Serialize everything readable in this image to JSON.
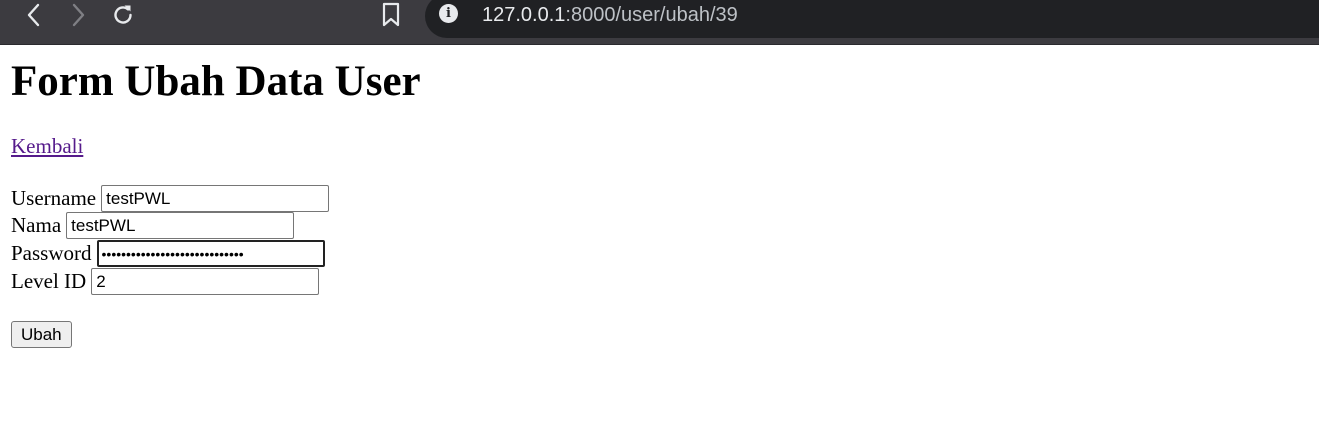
{
  "browser": {
    "url_host": "127.0.0.1",
    "url_path": ":8000/user/ubah/39",
    "info_glyph": "i",
    "icons": [
      "back-arrow-icon",
      "forward-arrow-icon",
      "reload-icon",
      "bookmark-icon",
      "info-icon"
    ]
  },
  "page": {
    "title": "Form Ubah Data User",
    "back_link": "Kembali",
    "link_color": "#551a8b"
  },
  "form": {
    "username_label": "Username",
    "username_value": "testPWL",
    "nama_label": "Nama",
    "nama_value": "testPWL",
    "password_label": "Password",
    "password_value": "$2y$12$abcdefghijklmnopqrstuv",
    "level_label": "Level ID",
    "level_value": "2",
    "submit_label": "Ubah"
  }
}
